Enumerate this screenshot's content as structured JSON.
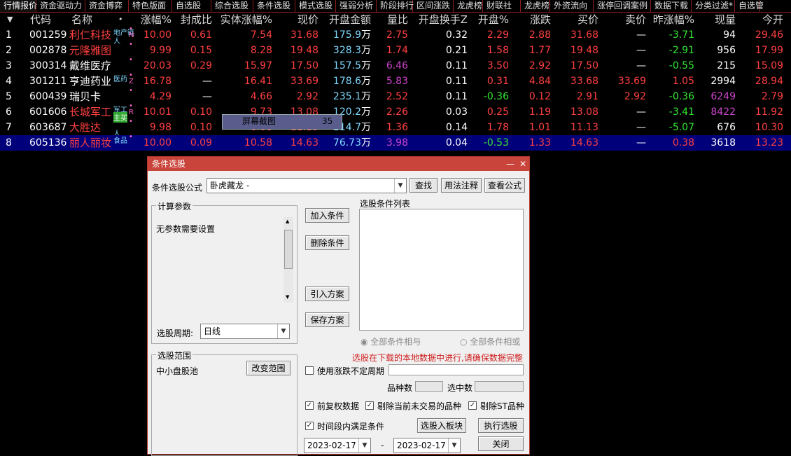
{
  "tabs": [
    "行情报价",
    "资金驱动力",
    "资金博弈",
    "特色版面",
    "自选股",
    "综合选股",
    "条件选股",
    "模式选股",
    "强弱分析",
    "阶段排行",
    "区间涨跌",
    "龙虎榜",
    "财联社",
    "龙虎榜",
    "外资流向",
    "涨停回调案例",
    "数据下载",
    "分类过滤*",
    "自选管"
  ],
  "headers": {
    "arrow": "▼",
    "code": "代码",
    "name": "名称",
    "dot": "•",
    "pct": "涨幅%",
    "seal": "封成比",
    "body": "实体涨幅%",
    "price": "现价",
    "amt": "开盘金额",
    "vr": "量比",
    "turn": "开盘换手Z",
    "open_pct": "开盘%",
    "chg": "涨跌",
    "bid": "买价",
    "ask": "卖价",
    "prev_pct": "昨涨幅%",
    "vol": "现量",
    "open": "今开"
  },
  "rows": [
    {
      "idx": "1",
      "code": "001259",
      "name": "利仁科技",
      "tag": "地产链",
      "tag2": "人",
      "mark": "N",
      "pct": "10.00",
      "seal": "0.61",
      "body": "7.54",
      "price": "31.68",
      "amt": "175.9",
      "unit": "万",
      "vr": "2.75",
      "turn": "0.32",
      "open_pct": "2.29",
      "chg": "2.88",
      "bid": "31.68",
      "ask": "—",
      "prev": "-3.71",
      "vol": "94",
      "open": "29.46"
    },
    {
      "idx": "2",
      "code": "002878",
      "name": "元隆雅图",
      "tag": "",
      "tag2": "",
      "mark": "",
      "pct": "9.99",
      "seal": "0.15",
      "body": "8.28",
      "price": "19.48",
      "amt": "328.3",
      "unit": "万",
      "vr": "1.74",
      "turn": "0.21",
      "open_pct": "1.58",
      "chg": "1.77",
      "bid": "19.48",
      "ask": "—",
      "prev": "-2.91",
      "vol": "956",
      "open": "17.99"
    },
    {
      "idx": "3",
      "code": "300314",
      "name": "戴维医疗",
      "tag": "",
      "tag2": "",
      "mark": "",
      "pct": "20.03",
      "seal": "0.29",
      "body": "15.97",
      "price": "17.50",
      "amt": "157.5",
      "unit": "万",
      "vr": "6.46",
      "turn": "0.11",
      "open_pct": "3.50",
      "chg": "2.92",
      "bid": "17.50",
      "ask": "—",
      "prev": "-0.55",
      "vol": "215",
      "open": "15.09"
    },
    {
      "idx": "4",
      "code": "301211",
      "name": "亨迪药业",
      "tag": "医药",
      "tag2": "",
      "mark": "Z",
      "pct": "16.78",
      "seal": "—",
      "body": "16.41",
      "price": "33.69",
      "amt": "178.6",
      "unit": "万",
      "vr": "5.83",
      "turn": "0.11",
      "open_pct": "0.31",
      "chg": "4.84",
      "bid": "33.68",
      "ask": "33.69",
      "prev": "1.05",
      "vol": "2994",
      "open": "28.94"
    },
    {
      "idx": "5",
      "code": "600439",
      "name": "瑞贝卡",
      "tag": "",
      "tag2": "",
      "mark": "",
      "pct": "4.29",
      "seal": "—",
      "body": "4.66",
      "price": "2.92",
      "amt": "235.1",
      "unit": "万",
      "vr": "2.52",
      "turn": "0.11",
      "open_pct": "-0.36",
      "chg": "0.12",
      "bid": "2.91",
      "ask": "2.92",
      "prev": "-0.36",
      "vol": "6249",
      "open": "2.79"
    },
    {
      "idx": "6",
      "code": "601606",
      "name": "长城军工",
      "tag": "军工",
      "tag2": "主买",
      "mark": "R",
      "pct": "10.01",
      "seal": "0.10",
      "body": "9.73",
      "price": "13.08",
      "amt": "120.2",
      "unit": "万",
      "vr": "2.26",
      "turn": "0.03",
      "open_pct": "0.25",
      "chg": "1.19",
      "bid": "13.08",
      "ask": "—",
      "prev": "-3.41",
      "vol": "8422",
      "open": "11.92"
    },
    {
      "idx": "7",
      "code": "603687",
      "name": "大胜达",
      "tag": "",
      "tag2": "人",
      "mark": "",
      "pct": "9.98",
      "seal": "0.10",
      "body": "8.88",
      "price": "11.13",
      "amt": "214.7",
      "unit": "万",
      "vr": "1.36",
      "turn": "0.14",
      "open_pct": "1.78",
      "chg": "1.01",
      "bid": "11.13",
      "ask": "—",
      "prev": "-5.07",
      "vol": "676",
      "open": "10.30"
    },
    {
      "idx": "8",
      "code": "605136",
      "name": "丽人丽妆",
      "tag": "食品",
      "tag2": "",
      "mark": "",
      "pct": "10.00",
      "seal": "0.09",
      "body": "10.58",
      "price": "14.63",
      "amt": "76.73",
      "unit": "万",
      "vr": "3.98",
      "turn": "0.04",
      "open_pct": "-0.53",
      "chg": "1.33",
      "bid": "14.63",
      "ask": "—",
      "prev": "0.38",
      "vol": "3618",
      "open": "13.23"
    }
  ],
  "overlay": {
    "label": "屏幕截图",
    "num": "35"
  },
  "dialog": {
    "title": "条件选股",
    "min": "—",
    "close": "✕",
    "formula_label": "条件选股公式",
    "formula_value": "卧虎藏龙      -",
    "btn_find": "查找",
    "btn_usage": "用法注释",
    "btn_view": "查看公式",
    "params_title": "计算参数",
    "params_text": "无参数需要设置",
    "period_label": "选股周期:",
    "period_value": "日线",
    "btn_add": "加入条件",
    "btn_del": "删除条件",
    "btn_import": "引入方案",
    "btn_save": "保存方案",
    "list_title": "选股条件列表",
    "radio_and": "全部条件相与",
    "radio_or": "全部条件相或",
    "warn": "选股在下载的本地数据中进行,请确保数据完整",
    "range_title": "选股范围",
    "range_value": "中小盘股池",
    "btn_range": "改变范围",
    "chk_indef": "使用涨跌不定周期",
    "count_label": "品种数",
    "selected_label": "选中数",
    "chk_fq": "前复权数据",
    "chk_exclude_notrade": "剔除当前未交易的品种",
    "chk_st": "剔除ST品种",
    "chk_period": "时间段内满足条件",
    "btn_block": "选股入板块",
    "btn_run": "执行选股",
    "date_from": "2023-02-17",
    "date_sep": "-",
    "date_to": "2023-02-17",
    "btn_close": "关闭"
  }
}
